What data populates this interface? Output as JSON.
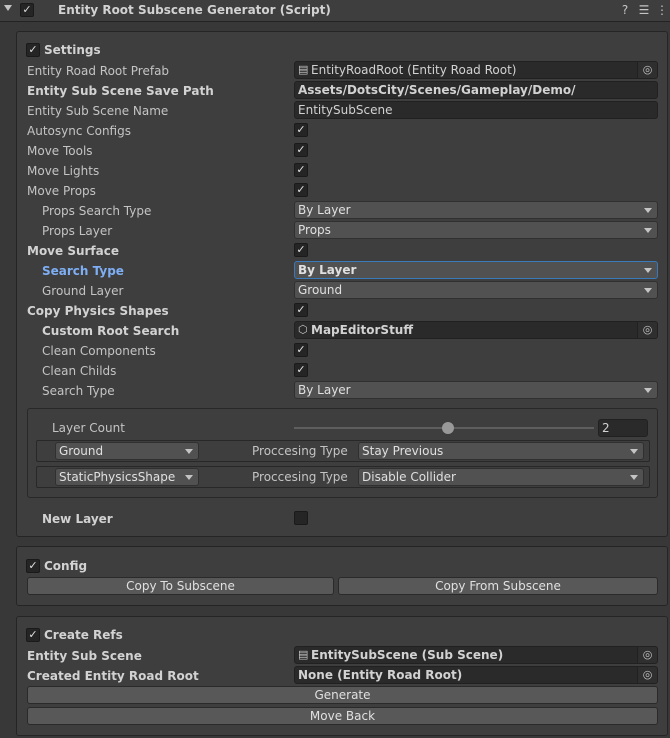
{
  "header": {
    "title": "Entity Root Subscene Generator (Script)",
    "enabled_mark": "✓"
  },
  "settings": {
    "title": "Settings",
    "entity_road_root_prefab": {
      "label": "Entity Road Root Prefab",
      "value": "EntityRoadRoot (Entity Road Root)"
    },
    "save_path": {
      "label": "Entity Sub Scene Save Path",
      "value": "Assets/DotsCity/Scenes/Gameplay/Demo/"
    },
    "sub_scene_name": {
      "label": "Entity Sub Scene Name",
      "value": "EntitySubScene"
    },
    "autosync_configs": {
      "label": "Autosync Configs",
      "checked": true
    },
    "move_tools": {
      "label": "Move Tools",
      "checked": true
    },
    "move_lights": {
      "label": "Move Lights",
      "checked": true
    },
    "move_props": {
      "label": "Move Props",
      "checked": true
    },
    "props_search_type": {
      "label": "Props Search Type",
      "value": "By Layer"
    },
    "props_layer": {
      "label": "Props Layer",
      "value": "Props"
    },
    "move_surface": {
      "label": "Move Surface",
      "checked": true
    },
    "search_type": {
      "label": "Search Type",
      "value": "By Layer"
    },
    "ground_layer": {
      "label": "Ground Layer",
      "value": "Ground"
    },
    "copy_physics_shapes": {
      "label": "Copy Physics Shapes",
      "checked": true
    },
    "custom_root_search": {
      "label": "Custom Root Search",
      "value": "MapEditorStuff"
    },
    "clean_components": {
      "label": "Clean Components",
      "checked": true
    },
    "clean_childs": {
      "label": "Clean Childs",
      "checked": true
    },
    "search_type_2": {
      "label": "Search Type",
      "value": "By Layer"
    },
    "layer_count": {
      "label": "Layer Count",
      "value": "2"
    },
    "layers": [
      {
        "layer": "Ground",
        "processing_label": "Proccesing Type",
        "processing_value": "Stay Previous"
      },
      {
        "layer": "StaticPhysicsShape",
        "processing_label": "Proccesing Type",
        "processing_value": "Disable Collider"
      }
    ],
    "new_layer": {
      "label": "New Layer",
      "checked": false
    }
  },
  "config": {
    "title": "Config",
    "copy_to_label": "Copy To Subscene",
    "copy_from_label": "Copy From Subscene"
  },
  "create_refs": {
    "title": "Create Refs",
    "entity_sub_scene": {
      "label": "Entity Sub Scene",
      "value": "EntitySubScene (Sub Scene)"
    },
    "created_root": {
      "label": "Created Entity Road Root",
      "value": "None (Entity Road Root)"
    },
    "generate_label": "Generate",
    "move_back_label": "Move Back"
  },
  "checkmark": "✓",
  "colors": {
    "background": "#383838",
    "panel": "#3e3e3e",
    "accent": "#7eaef3",
    "focus": "#3a79bb"
  }
}
